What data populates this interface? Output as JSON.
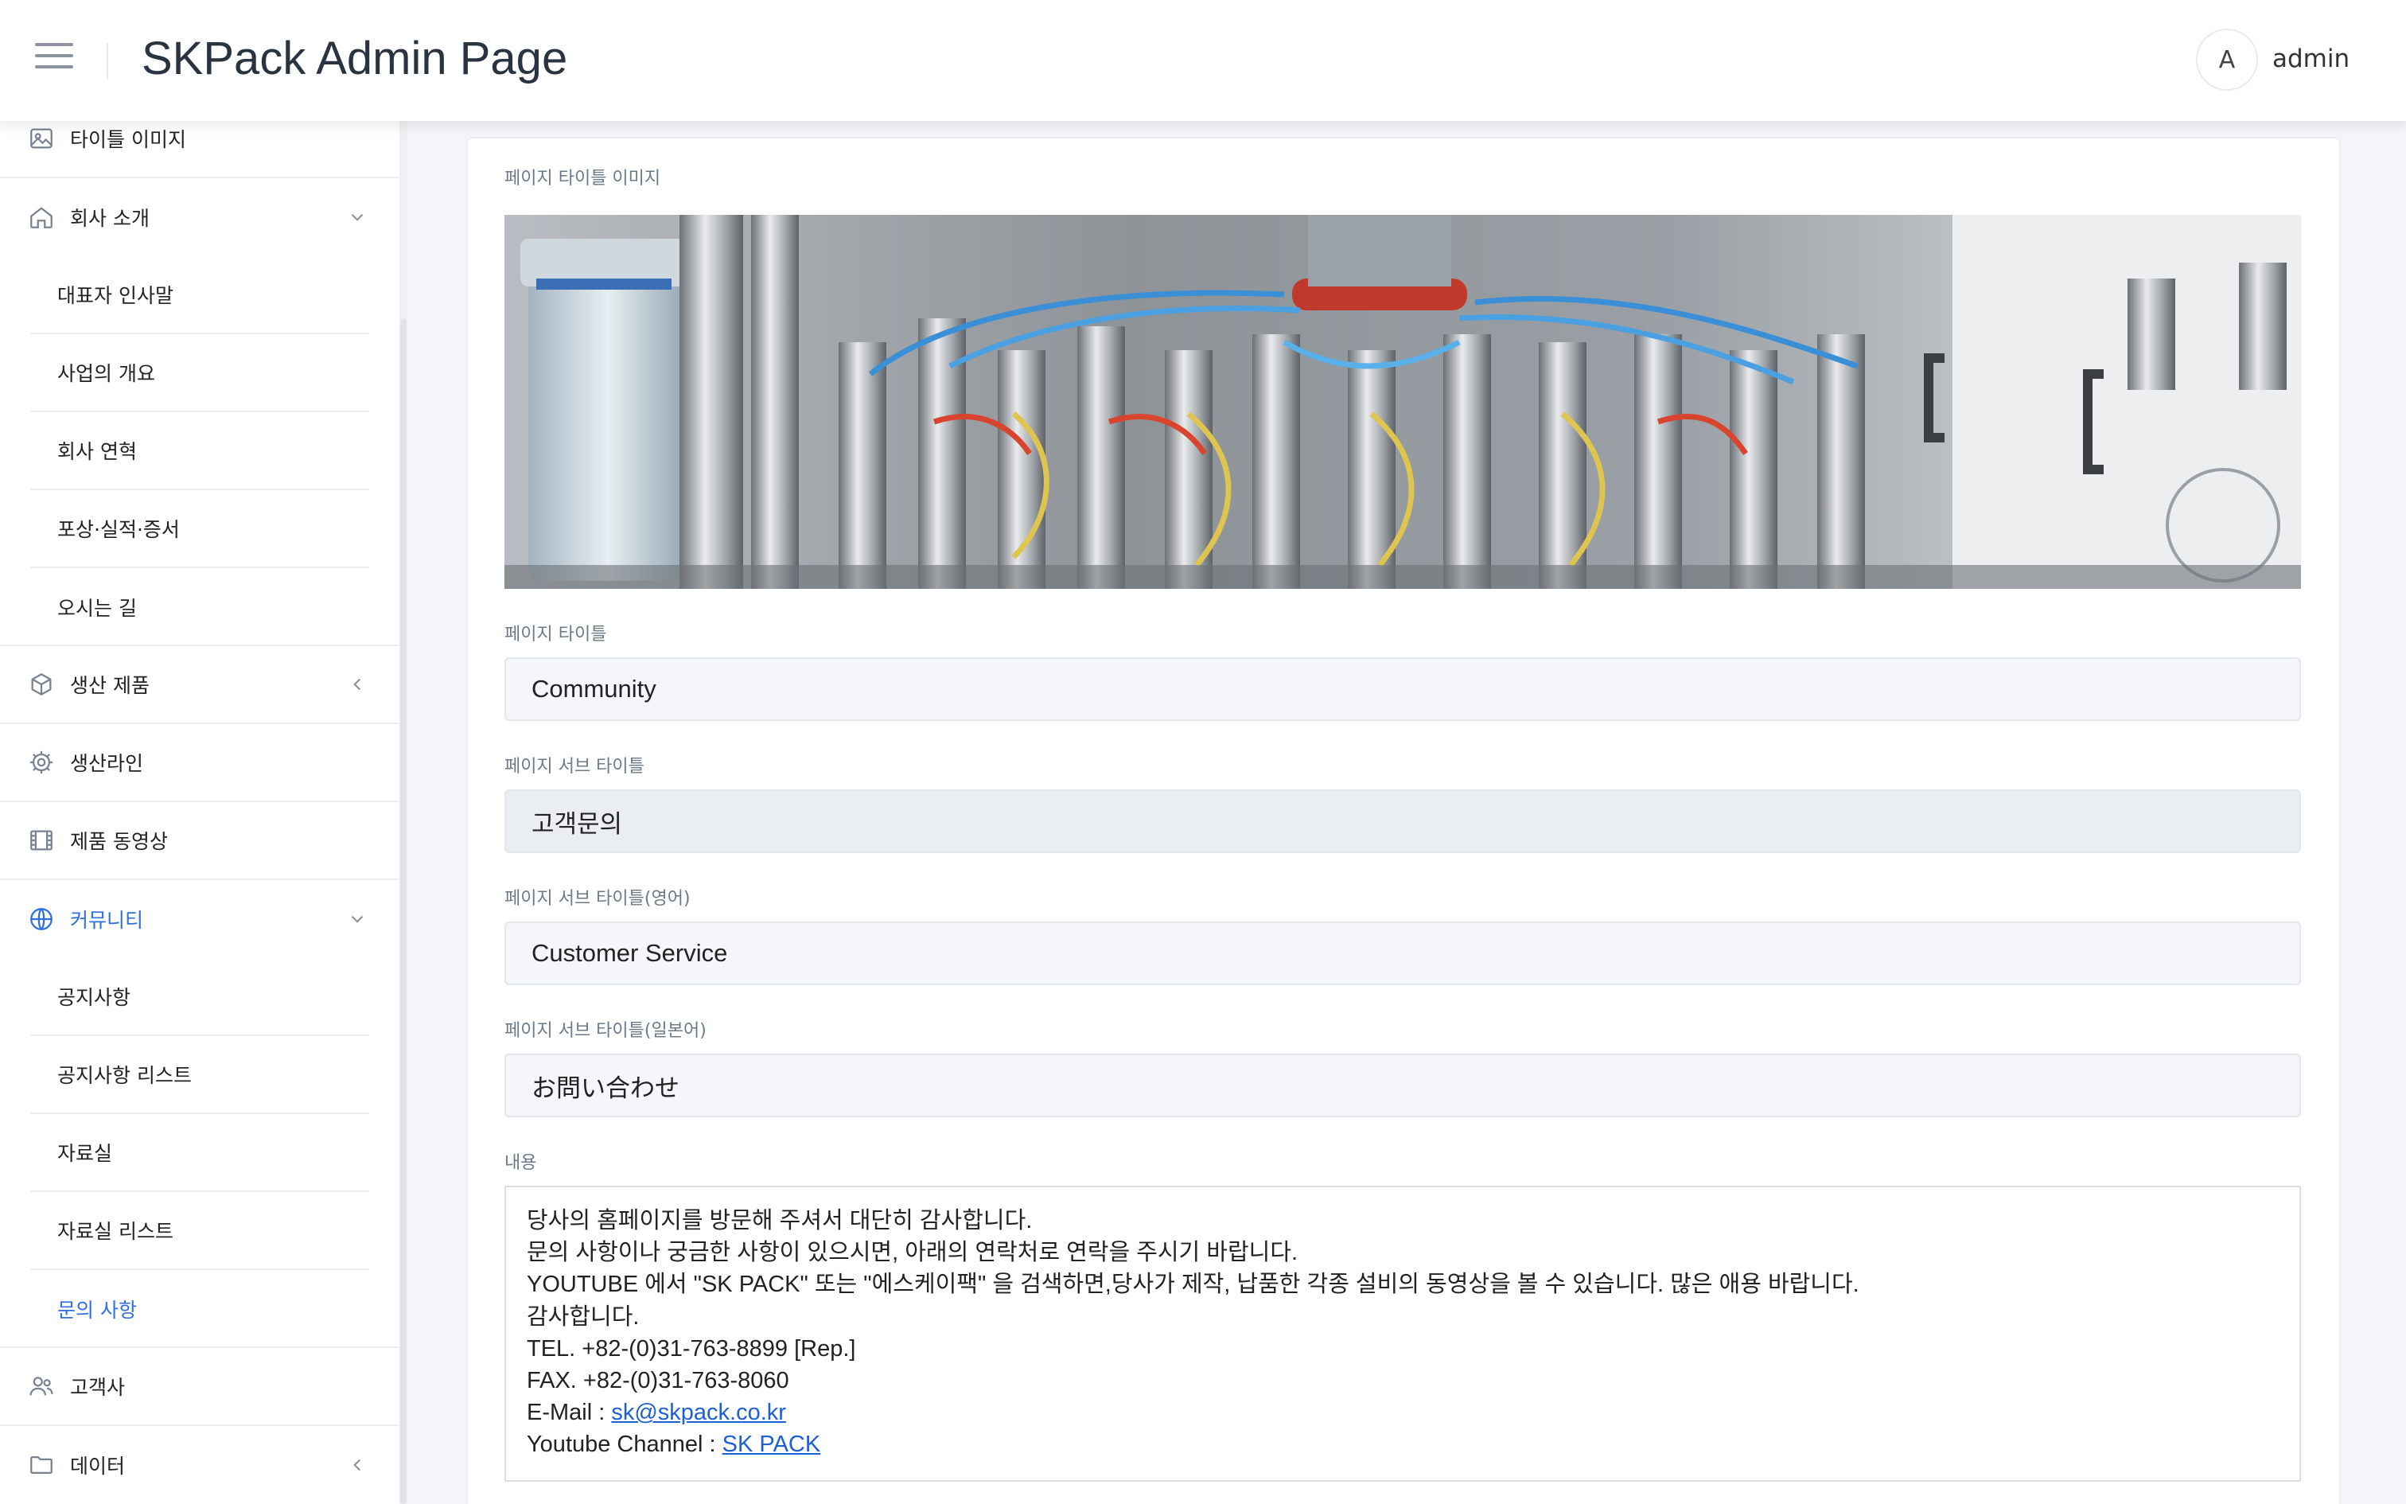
{
  "header": {
    "title": "SKPack Admin Page",
    "avatar_initial": "A",
    "username": "admin"
  },
  "sidebar": {
    "items": [
      {
        "label": "타이틀 이미지",
        "icon": "image-icon"
      },
      {
        "label": "회사 소개",
        "icon": "home-icon",
        "expanded": true
      },
      {
        "label": "대표자 인사말"
      },
      {
        "label": "사업의 개요"
      },
      {
        "label": "회사 연혁"
      },
      {
        "label": "포상·실적·증서"
      },
      {
        "label": "오시는 길"
      },
      {
        "label": "생산 제품",
        "icon": "cube-icon",
        "expanded": false
      },
      {
        "label": "생산라인",
        "icon": "gear-icon"
      },
      {
        "label": "제품 동영상",
        "icon": "film-icon"
      },
      {
        "label": "커뮤니티",
        "icon": "globe-icon",
        "expanded": true,
        "active": true
      },
      {
        "label": "공지사항"
      },
      {
        "label": "공지사항 리스트"
      },
      {
        "label": "자료실"
      },
      {
        "label": "자료실 리스트"
      },
      {
        "label": "문의 사항",
        "active": true
      },
      {
        "label": "고객사",
        "icon": "users-icon"
      },
      {
        "label": "데이터",
        "icon": "folder-icon",
        "expanded": false
      }
    ]
  },
  "form": {
    "title_image_label": "페이지 타이틀 이미지",
    "page_title_label": "페이지 타이틀",
    "page_title_value": "Community",
    "sub_title_label": "페이지 서브 타이틀",
    "sub_title_value": "고객문의",
    "sub_title_en_label": "페이지 서브 타이틀(영어)",
    "sub_title_en_value": "Customer Service",
    "sub_title_ja_label": "페이지 서브 타이틀(일본어)",
    "sub_title_ja_value": "お問い合わせ",
    "content_label": "내용",
    "content": {
      "line1": "당사의 홈페이지를 방문해 주셔서 대단히 감사합니다.",
      "line2": "문의 사항이나 궁금한 사항이 있으시면, 아래의 연락처로 연락을 주시기 바랍니다.",
      "line3": "YOUTUBE 에서 \"SK PACK\" 또는 \"에스케이팩\" 을 검색하면,당사가 제작, 납품한 각종 설비의 동영상을 볼 수 있습니다. 많은 애용 바랍니다.",
      "line4": "감사합니다.",
      "line5": "TEL. +82-(0)31-763-8899 [Rep.]",
      "line6": "FAX. +82-(0)31-763-8060",
      "email_prefix": "E-Mail : ",
      "email_link": "sk@skpack.co.kr",
      "youtube_prefix": "Youtube Channel : ",
      "youtube_link": "SK PACK"
    }
  },
  "colors": {
    "accent": "#2f6fde",
    "link": "#1f5fd6"
  }
}
